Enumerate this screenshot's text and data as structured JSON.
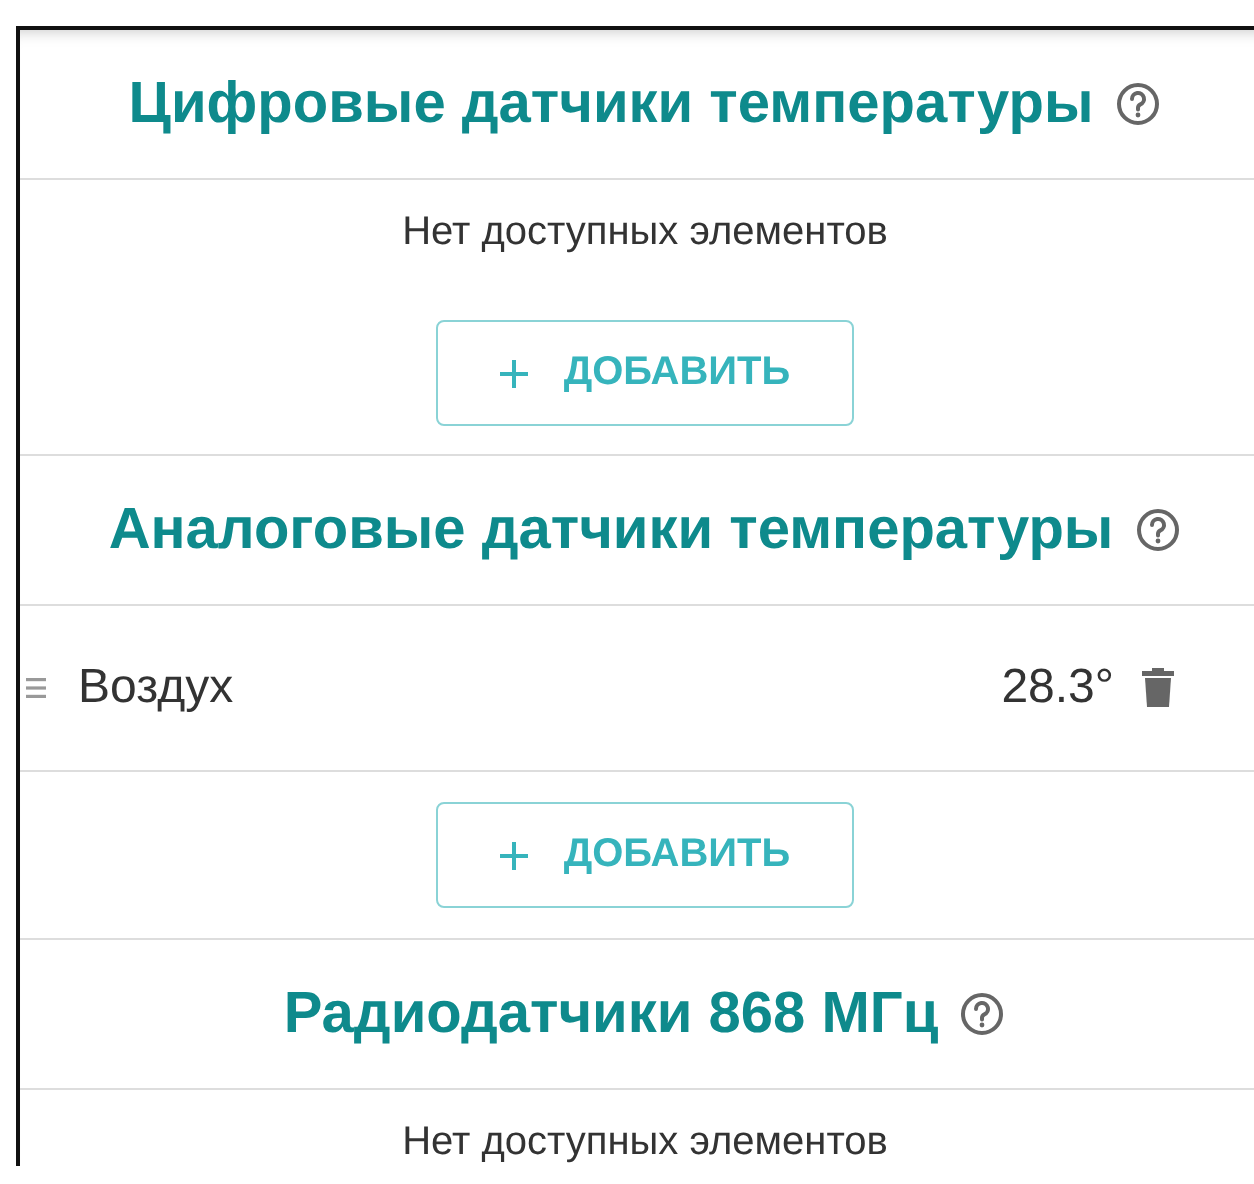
{
  "sections": [
    {
      "title": "Цифровые датчики температуры",
      "empty_text": "Нет доступных элементов",
      "add_button": "ДОБАВИТЬ"
    },
    {
      "title": "Аналоговые датчики температуры",
      "items": [
        {
          "name": "Воздух",
          "value": "28.3°"
        }
      ],
      "add_button": "ДОБАВИТЬ"
    },
    {
      "title": "Радиодатчики 868 МГц",
      "empty_text": "Нет доступных элементов"
    }
  ]
}
